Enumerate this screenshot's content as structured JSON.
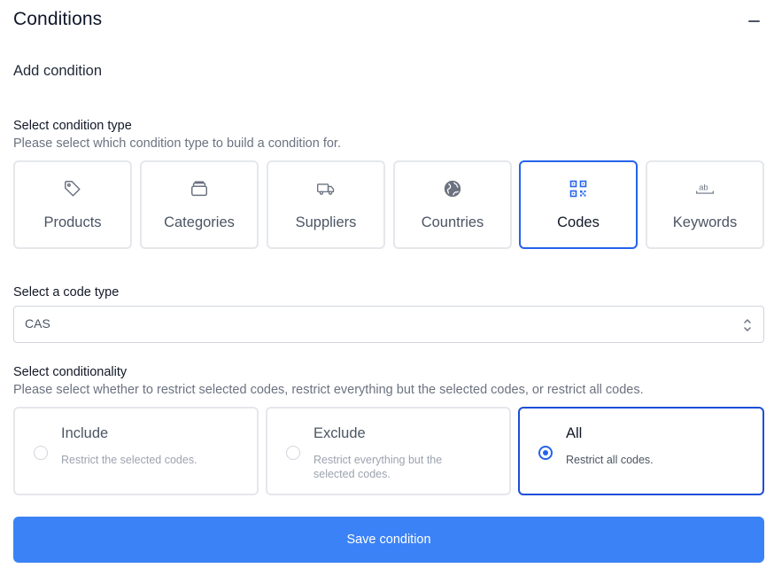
{
  "section": {
    "title": "Conditions"
  },
  "add_condition": {
    "title": "Add condition"
  },
  "condition_type": {
    "label": "Select condition type",
    "help": "Please select which condition type to build a condition for.",
    "options": [
      {
        "label": "Products",
        "icon": "tag-icon",
        "selected": false
      },
      {
        "label": "Categories",
        "icon": "archive-icon",
        "selected": false
      },
      {
        "label": "Suppliers",
        "icon": "truck-icon",
        "selected": false
      },
      {
        "label": "Countries",
        "icon": "globe-icon",
        "selected": false
      },
      {
        "label": "Codes",
        "icon": "qr-code-icon",
        "selected": true
      },
      {
        "label": "Keywords",
        "icon": "text-ab-icon",
        "selected": false
      }
    ]
  },
  "code_type": {
    "label": "Select a code type",
    "value": "CAS"
  },
  "conditionality": {
    "label": "Select conditionality",
    "help": "Please select whether to restrict selected codes, restrict everything but the selected codes, or restrict all codes.",
    "options": [
      {
        "title": "Include",
        "description": "Restrict the selected codes.",
        "selected": false
      },
      {
        "title": "Exclude",
        "description": "Restrict everything but the selected codes.",
        "selected": false
      },
      {
        "title": "All",
        "description": "Restrict all codes.",
        "selected": true
      }
    ]
  },
  "save_button": {
    "label": "Save condition"
  },
  "colors": {
    "accent": "#3b82f6",
    "selected_border": "#2563eb",
    "card_border": "#e5e7eb"
  }
}
